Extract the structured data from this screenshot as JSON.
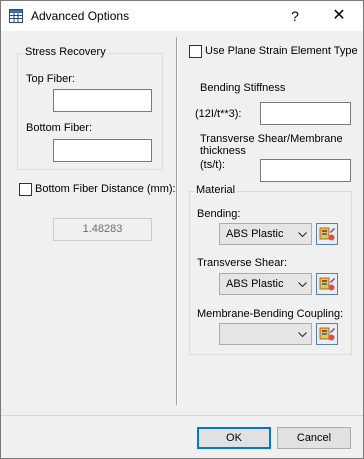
{
  "window": {
    "title": "Advanced Options",
    "help_glyph": "?",
    "close_glyph": "✕"
  },
  "stress_recovery": {
    "group_title": "Stress Recovery",
    "top_fiber_label": "Top Fiber:",
    "top_fiber_value": "",
    "bottom_fiber_label": "Bottom Fiber:",
    "bottom_fiber_value": ""
  },
  "bottom_fiber_distance": {
    "label": "Bottom Fiber Distance (mm):",
    "checked": false,
    "value": "1.48283"
  },
  "right_panel": {
    "plane_strain_label": "Use Plane Strain Element Type",
    "plane_strain_checked": false,
    "bending_stiffness_label": "Bending Stiffness",
    "bending_stiffness_formula": "(12I/t**3):",
    "bending_stiffness_value": "",
    "transverse_shear_label": "Transverse Shear/Membrane thickness",
    "transverse_shear_formula": "(ts/t):",
    "transverse_shear_value": ""
  },
  "material": {
    "group_title": "Material",
    "bending_label": "Bending:",
    "bending_value": "ABS Plastic",
    "transverse_label": "Transverse Shear:",
    "transverse_value": "ABS Plastic",
    "coupling_label": "Membrane-Bending Coupling:",
    "coupling_value": ""
  },
  "footer": {
    "ok_label": "OK",
    "cancel_label": "Cancel"
  },
  "icons": {
    "app": "dialog-grid-icon",
    "material_browse": "material-library-icon"
  }
}
